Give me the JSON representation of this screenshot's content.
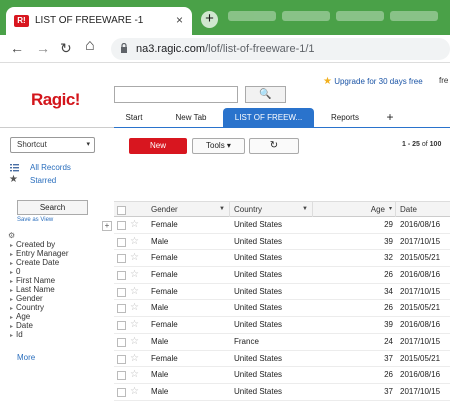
{
  "browser": {
    "tab_favicon": "R!",
    "tab_title": "LIST OF FREEWARE -1",
    "tab_close": "×",
    "new_tab": "+",
    "back": "←",
    "forward": "→",
    "reload": "↻",
    "home": "⌂",
    "url_host": "na3.ragic.com",
    "url_path": "/lof/list-of-freeware-1/1"
  },
  "header": {
    "logo": "Ragic!",
    "upgrade_star": "★",
    "upgrade": "Upgrade for 30 days free",
    "user_fragment": "fre",
    "search_placeholder": "",
    "search_btn": "🔍"
  },
  "navtabs": [
    "Start",
    "New Tab",
    "LIST OF FREEW...",
    "Reports",
    "+"
  ],
  "sidebar": {
    "shortcut": "Shortcut",
    "shortcut_caret": "▾",
    "all_records": "All Records",
    "starred": "Starred",
    "search": "Search",
    "save_as_view": "Save as View",
    "add": "+",
    "gear": "⚙",
    "fields": [
      "Created by",
      "Entry Manager",
      "Create Date",
      "0",
      "First Name",
      "Last Name",
      "Gender",
      "Country",
      "Age",
      "Date",
      "Id"
    ],
    "more": "More"
  },
  "toolbar": {
    "new": "New",
    "tools": "Tools ▾",
    "refresh": "↻",
    "count_range": "1 - 25",
    "count_of": "of",
    "count_total": "100"
  },
  "grid": {
    "headers": {
      "gender": "Gender",
      "country": "Country",
      "age": "Age",
      "date": "Date"
    },
    "rows": [
      {
        "gender": "Female",
        "country": "United States",
        "age": "29",
        "date": "2016/08/16"
      },
      {
        "gender": "Male",
        "country": "United States",
        "age": "39",
        "date": "2017/10/15"
      },
      {
        "gender": "Female",
        "country": "United States",
        "age": "32",
        "date": "2015/05/21"
      },
      {
        "gender": "Female",
        "country": "United States",
        "age": "26",
        "date": "2016/08/16"
      },
      {
        "gender": "Female",
        "country": "United States",
        "age": "34",
        "date": "2017/10/15"
      },
      {
        "gender": "Male",
        "country": "United States",
        "age": "26",
        "date": "2015/05/21"
      },
      {
        "gender": "Female",
        "country": "United States",
        "age": "39",
        "date": "2016/08/16"
      },
      {
        "gender": "Male",
        "country": "France",
        "age": "24",
        "date": "2017/10/15"
      },
      {
        "gender": "Female",
        "country": "United States",
        "age": "37",
        "date": "2015/05/21"
      },
      {
        "gender": "Male",
        "country": "United States",
        "age": "26",
        "date": "2016/08/16"
      },
      {
        "gender": "Male",
        "country": "United States",
        "age": "37",
        "date": "2017/10/15"
      }
    ]
  },
  "colors": {
    "chrome_green": "#4aa148",
    "brand_red": "#d8161f",
    "accent_blue": "#2a73cc",
    "link_blue": "#2a6ebd"
  }
}
